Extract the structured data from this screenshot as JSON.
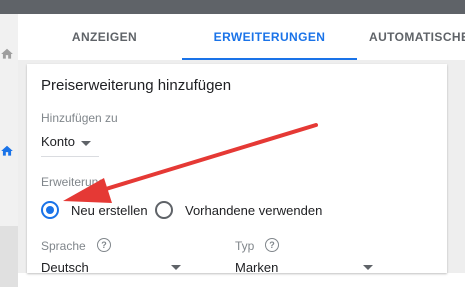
{
  "tabs": [
    {
      "label": "ANZEIGEN",
      "active": false
    },
    {
      "label": "ERWEITERUNGEN",
      "active": true
    },
    {
      "label": "AUTOMATISCHE E",
      "active": false
    }
  ],
  "card": {
    "title": "Preiserweiterung hinzufügen",
    "add_to_label": "Hinzufügen zu",
    "add_to_value": "Konto",
    "extension_label": "Erweiterung",
    "radio_options": [
      {
        "label": "Neu erstellen",
        "selected": true
      },
      {
        "label": "Vorhandene verwenden",
        "selected": false
      }
    ],
    "language_label": "Sprache",
    "language_value": "Deutsch",
    "type_label": "Typ",
    "type_value": "Marken",
    "help_glyph": "?"
  },
  "colors": {
    "accent": "#1a73e8",
    "annotation_arrow": "#e53935"
  },
  "icons": {
    "rail_top": "home-icon",
    "rail_active": "home-icon"
  }
}
